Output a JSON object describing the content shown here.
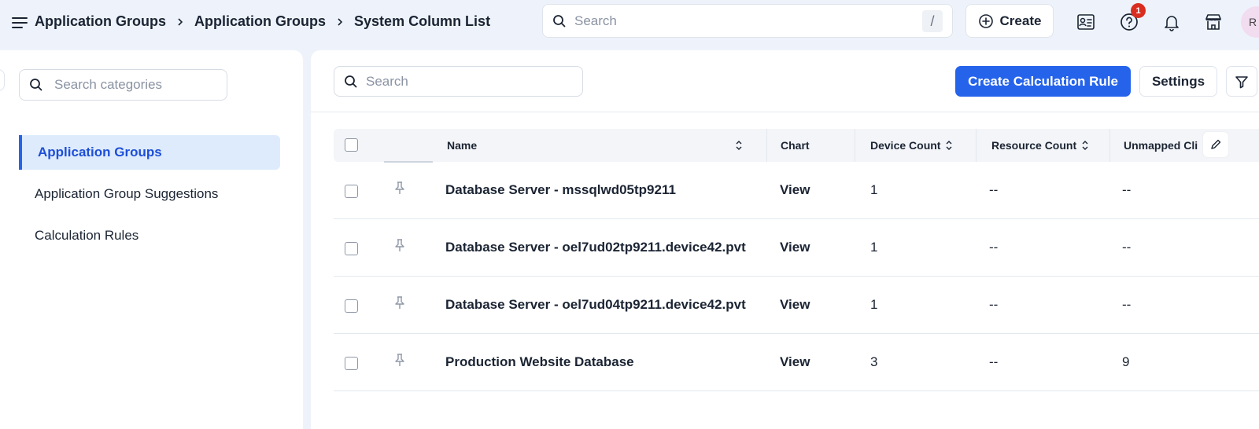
{
  "breadcrumbs": [
    "Application Groups",
    "Application Groups",
    "System Column List"
  ],
  "global_search": {
    "placeholder": "Search",
    "shortcut": "/"
  },
  "create_button": {
    "label": "Create"
  },
  "notifications": {
    "help_badge": "1"
  },
  "avatar": {
    "initial": "R"
  },
  "sidebar": {
    "search_placeholder": "Search categories",
    "items": [
      {
        "label": "Application Groups",
        "active": true
      },
      {
        "label": "Application Group Suggestions",
        "active": false
      },
      {
        "label": "Calculation Rules",
        "active": false
      }
    ]
  },
  "toolbar": {
    "search_placeholder": "Search",
    "create_rule_label": "Create Calculation Rule",
    "settings_label": "Settings"
  },
  "table": {
    "columns": [
      "Name",
      "Chart",
      "Device Count",
      "Resource Count",
      "Unmapped Cli"
    ],
    "rows": [
      {
        "name": "Database Server - mssqlwd05tp9211",
        "chart": "View",
        "device_count": "1",
        "resource_count": "--",
        "unmapped": "--"
      },
      {
        "name": "Database Server - oel7ud02tp9211.device42.pvt",
        "chart": "View",
        "device_count": "1",
        "resource_count": "--",
        "unmapped": "--"
      },
      {
        "name": "Database Server - oel7ud04tp9211.device42.pvt",
        "chart": "View",
        "device_count": "1",
        "resource_count": "--",
        "unmapped": "--"
      },
      {
        "name": "Production Website Database",
        "chart": "View",
        "device_count": "3",
        "resource_count": "--",
        "unmapped": "9"
      }
    ]
  },
  "colors": {
    "accent": "#2563eb",
    "active_bg": "#deebfc",
    "badge": "#d92d20"
  }
}
